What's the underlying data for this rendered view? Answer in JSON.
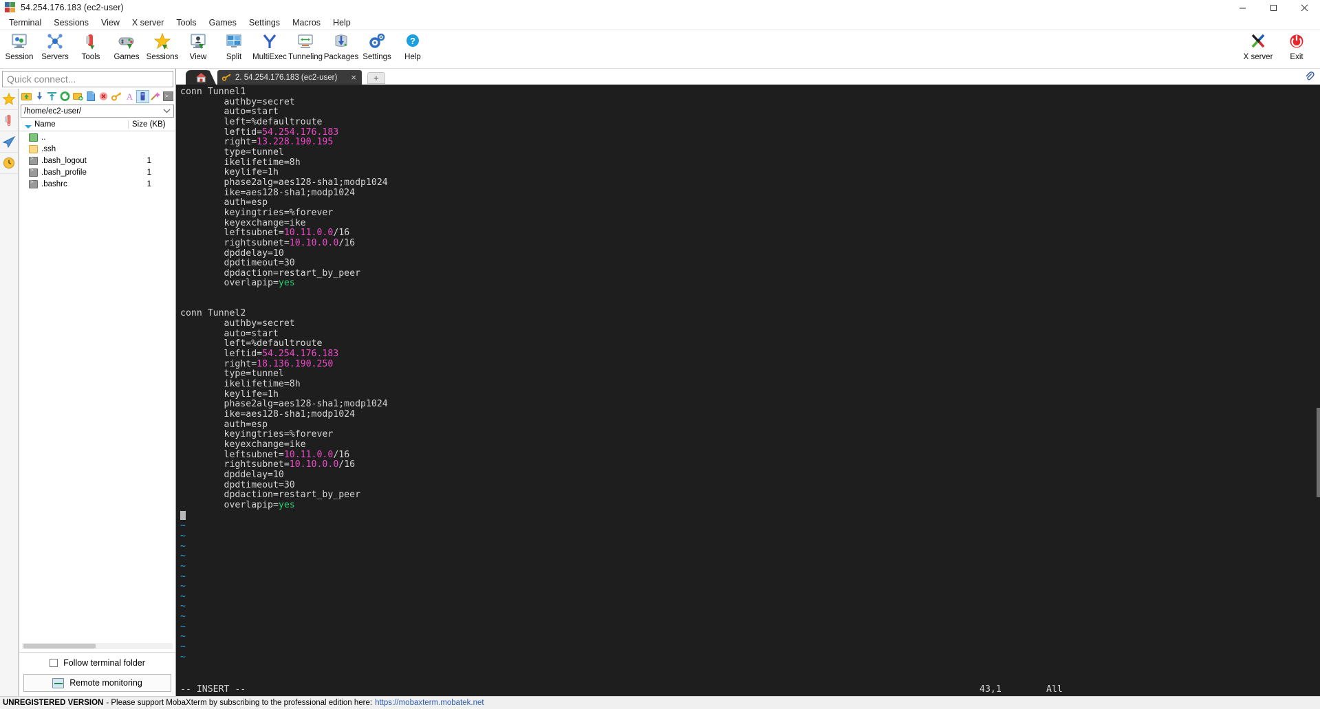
{
  "window": {
    "title": "54.254.176.183 (ec2-user)",
    "icon": "mobaxterm-logo-icon",
    "buttons": {
      "minimize": "minimize",
      "maximize": "maximize",
      "close": "close"
    }
  },
  "menubar": {
    "items": [
      "Terminal",
      "Sessions",
      "View",
      "X server",
      "Tools",
      "Games",
      "Settings",
      "Macros",
      "Help"
    ]
  },
  "toolbar": {
    "buttons": [
      {
        "label": "Session",
        "icon": "session-icon"
      },
      {
        "label": "Servers",
        "icon": "servers-icon"
      },
      {
        "label": "Tools",
        "icon": "tools-icon"
      },
      {
        "label": "Games",
        "icon": "games-icon"
      },
      {
        "label": "Sessions",
        "icon": "sessions-star-icon"
      },
      {
        "label": "View",
        "icon": "view-icon"
      },
      {
        "label": "Split",
        "icon": "split-icon"
      },
      {
        "label": "MultiExec",
        "icon": "multiexec-icon"
      },
      {
        "label": "Tunneling",
        "icon": "tunneling-icon"
      },
      {
        "label": "Packages",
        "icon": "packages-icon"
      },
      {
        "label": "Settings",
        "icon": "settings-gear-icon"
      },
      {
        "label": "Help",
        "icon": "help-question-icon"
      }
    ],
    "right_buttons": [
      {
        "label": "X server",
        "icon": "x-server-icon"
      },
      {
        "label": "Exit",
        "icon": "power-exit-icon"
      }
    ]
  },
  "sidebar": {
    "quick_connect_placeholder": "Quick connect...",
    "vertical_tabs": [
      {
        "name": "sessions-star-tab",
        "icon": "star-icon"
      },
      {
        "name": "tools-tab",
        "icon": "swiss-knife-icon"
      },
      {
        "name": "macros-tab",
        "icon": "paper-plane-icon"
      },
      {
        "name": "sftp-tab",
        "icon": "clock-icon"
      }
    ],
    "browser_toolbar": [
      {
        "name": "parent-folder",
        "icon": "folder-up-icon"
      },
      {
        "name": "download",
        "icon": "download-icon"
      },
      {
        "name": "upload",
        "icon": "upload-icon"
      },
      {
        "name": "refresh",
        "icon": "refresh-icon"
      },
      {
        "name": "new-folder",
        "icon": "new-folder-icon"
      },
      {
        "name": "new-file",
        "icon": "new-file-icon"
      },
      {
        "name": "delete",
        "icon": "delete-icon"
      },
      {
        "name": "permissions",
        "icon": "key-icon"
      },
      {
        "name": "text-mode",
        "icon": "font-a-icon"
      },
      {
        "name": "binary-mode",
        "icon": "binary-icon"
      },
      {
        "name": "magic-tools",
        "icon": "magic-wand-icon"
      },
      {
        "name": "terminal-here",
        "icon": "terminal-icon"
      }
    ],
    "path": "/home/ec2-user/",
    "columns": [
      "Name",
      "Size (KB)"
    ],
    "files": [
      {
        "name": "..",
        "size": "",
        "kind": "folderup"
      },
      {
        "name": ".ssh",
        "size": "",
        "kind": "folder"
      },
      {
        "name": ".bash_logout",
        "size": "1",
        "kind": "script"
      },
      {
        "name": ".bash_profile",
        "size": "1",
        "kind": "script"
      },
      {
        "name": ".bashrc",
        "size": "1",
        "kind": "script"
      }
    ],
    "follow_terminal_folder": {
      "label": "Follow terminal folder",
      "checked": false
    },
    "remote_monitoring": {
      "label": "Remote monitoring",
      "icon": "monitor-graph-icon"
    }
  },
  "tabs": {
    "home_tab": {
      "name": "home-tab",
      "icon": "home-icon"
    },
    "session_tab": {
      "label": "2. 54.254.176.183 (ec2-user)",
      "icon": "ssh-key-icon",
      "close": "×"
    },
    "new_tab": {
      "label": "+"
    },
    "clip_icon": "paperclip-icon"
  },
  "terminal": {
    "lines": [
      [
        {
          "t": "conn Tunnel1"
        }
      ],
      [
        {
          "t": "        authby=secret"
        }
      ],
      [
        {
          "t": "        auto=start"
        }
      ],
      [
        {
          "t": "        left=%defaultroute"
        }
      ],
      [
        {
          "t": "        leftid="
        },
        {
          "t": "54.254.176.183",
          "c": "ip"
        }
      ],
      [
        {
          "t": "        right="
        },
        {
          "t": "13.228.190.195",
          "c": "ip"
        }
      ],
      [
        {
          "t": "        type=tunnel"
        }
      ],
      [
        {
          "t": "        ikelifetime=8h"
        }
      ],
      [
        {
          "t": "        keylife=1h"
        }
      ],
      [
        {
          "t": "        phase2alg=aes128-sha1;modp1024"
        }
      ],
      [
        {
          "t": "        ike=aes128-sha1;modp1024"
        }
      ],
      [
        {
          "t": "        auth=esp"
        }
      ],
      [
        {
          "t": "        keyingtries=%forever"
        }
      ],
      [
        {
          "t": "        keyexchange=ike"
        }
      ],
      [
        {
          "t": "        leftsubnet="
        },
        {
          "t": "10.11.0.0",
          "c": "ip"
        },
        {
          "t": "/16"
        }
      ],
      [
        {
          "t": "        rightsubnet="
        },
        {
          "t": "10.10.0.0",
          "c": "ip"
        },
        {
          "t": "/16"
        }
      ],
      [
        {
          "t": "        dpddelay=10"
        }
      ],
      [
        {
          "t": "        dpdtimeout=30"
        }
      ],
      [
        {
          "t": "        dpdaction=restart_by_peer"
        }
      ],
      [
        {
          "t": "        overlapip="
        },
        {
          "t": "yes",
          "c": "grn"
        }
      ],
      [
        {
          "t": ""
        }
      ],
      [
        {
          "t": ""
        }
      ],
      [
        {
          "t": "conn Tunnel2"
        }
      ],
      [
        {
          "t": "        authby=secret"
        }
      ],
      [
        {
          "t": "        auto=start"
        }
      ],
      [
        {
          "t": "        left=%defaultroute"
        }
      ],
      [
        {
          "t": "        leftid="
        },
        {
          "t": "54.254.176.183",
          "c": "ip"
        }
      ],
      [
        {
          "t": "        right="
        },
        {
          "t": "18.136.190.250",
          "c": "ip"
        }
      ],
      [
        {
          "t": "        type=tunnel"
        }
      ],
      [
        {
          "t": "        ikelifetime=8h"
        }
      ],
      [
        {
          "t": "        keylife=1h"
        }
      ],
      [
        {
          "t": "        phase2alg=aes128-sha1;modp1024"
        }
      ],
      [
        {
          "t": "        ike=aes128-sha1;modp1024"
        }
      ],
      [
        {
          "t": "        auth=esp"
        }
      ],
      [
        {
          "t": "        keyingtries=%forever"
        }
      ],
      [
        {
          "t": "        keyexchange=ike"
        }
      ],
      [
        {
          "t": "        leftsubnet="
        },
        {
          "t": "10.11.0.0",
          "c": "ip"
        },
        {
          "t": "/16"
        }
      ],
      [
        {
          "t": "        rightsubnet="
        },
        {
          "t": "10.10.0.0",
          "c": "ip"
        },
        {
          "t": "/16"
        }
      ],
      [
        {
          "t": "        dpddelay=10"
        }
      ],
      [
        {
          "t": "        dpdtimeout=30"
        }
      ],
      [
        {
          "t": "        dpdaction=restart_by_peer"
        }
      ],
      [
        {
          "t": "        overlapip="
        },
        {
          "t": "yes",
          "c": "grn"
        }
      ],
      [
        {
          "cursor": true
        }
      ],
      [
        {
          "t": "~",
          "c": "tilde"
        }
      ],
      [
        {
          "t": "~",
          "c": "tilde"
        }
      ],
      [
        {
          "t": "~",
          "c": "tilde"
        }
      ],
      [
        {
          "t": "~",
          "c": "tilde"
        }
      ],
      [
        {
          "t": "~",
          "c": "tilde"
        }
      ],
      [
        {
          "t": "~",
          "c": "tilde"
        }
      ],
      [
        {
          "t": "~",
          "c": "tilde"
        }
      ],
      [
        {
          "t": "~",
          "c": "tilde"
        }
      ],
      [
        {
          "t": "~",
          "c": "tilde"
        }
      ],
      [
        {
          "t": "~",
          "c": "tilde"
        }
      ],
      [
        {
          "t": "~",
          "c": "tilde"
        }
      ],
      [
        {
          "t": "~",
          "c": "tilde"
        }
      ],
      [
        {
          "t": "~",
          "c": "tilde"
        }
      ],
      [
        {
          "t": "~",
          "c": "tilde"
        }
      ]
    ],
    "status": {
      "mode": "-- INSERT --",
      "position": "43,1",
      "scroll": "All"
    },
    "colors": {
      "background": "#1e1e1e",
      "foreground": "#d6d6d6",
      "ip": "#f04ac8",
      "value": "#2ecc71",
      "tilde": "#2aa5e0"
    }
  },
  "bottombar": {
    "unregistered": "UNREGISTERED VERSION",
    "message": "-  Please support MobaXterm by subscribing to the professional edition here:",
    "link": "https://mobaxterm.mobatek.net"
  }
}
